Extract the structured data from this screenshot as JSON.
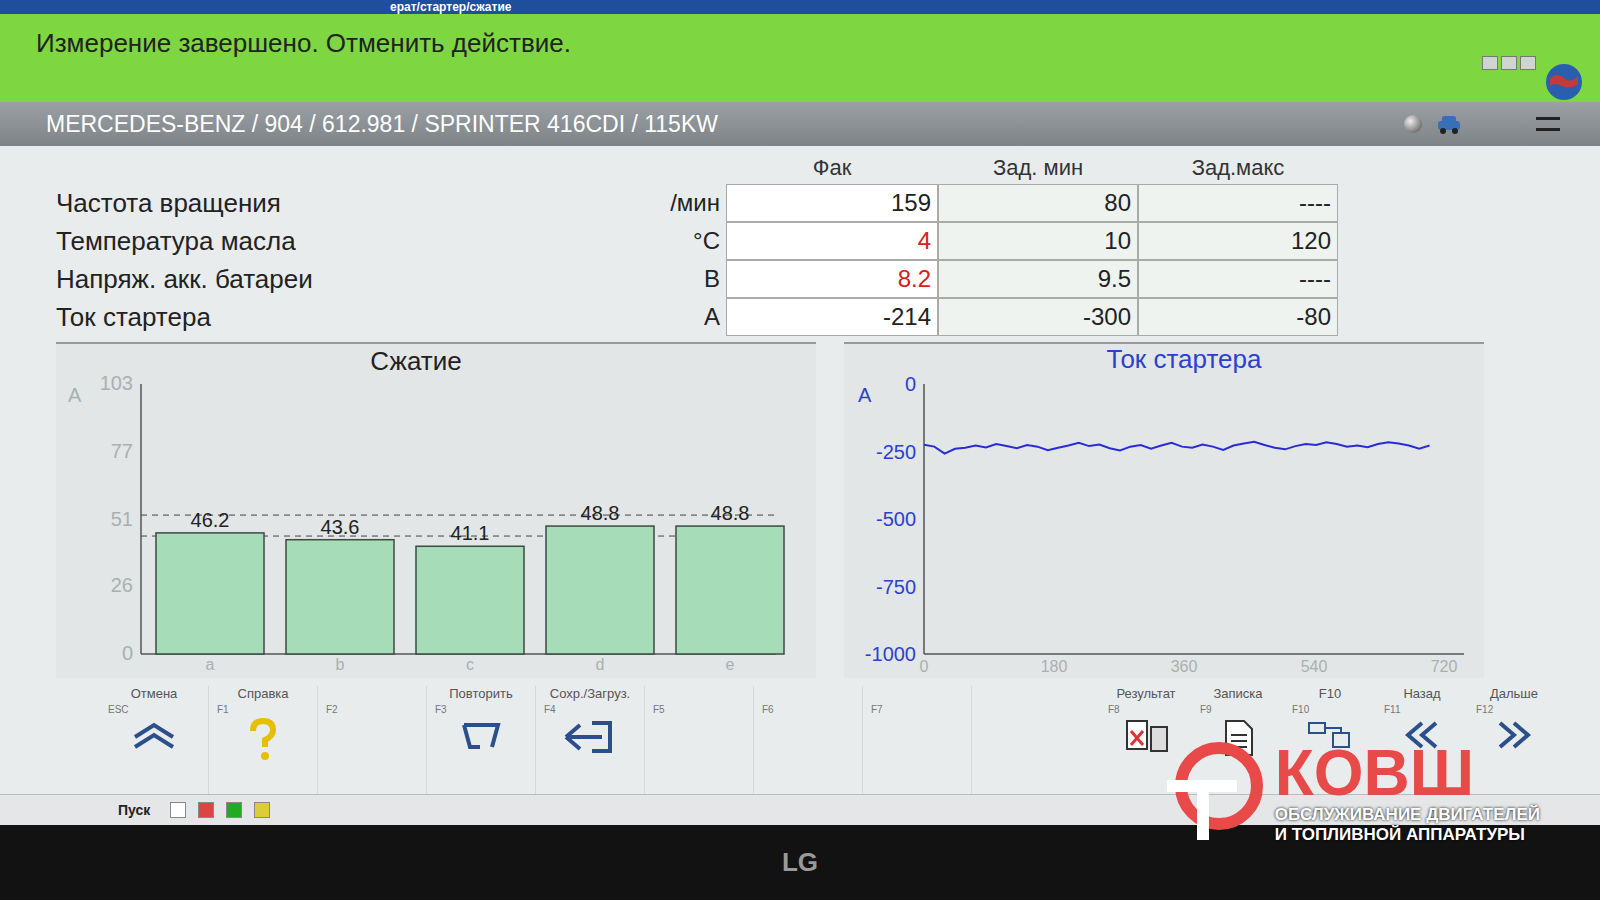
{
  "path": "ерат/стартер/сжатие",
  "banner": {
    "message": "Измерение завершено. Отменить действие."
  },
  "vehicle": "MERCEDES-BENZ / 904 / 612.981 / SPRINTER 416CDI / 115KW",
  "table": {
    "columns": [
      "Фак",
      "Зад. мин",
      "Зад.макс"
    ],
    "rows": [
      {
        "name": "Частота вращения",
        "unit": "/мин",
        "actual": "159",
        "alarm": false,
        "min": "80",
        "max": "----"
      },
      {
        "name": "Температура масла",
        "unit": "°C",
        "actual": "4",
        "alarm": true,
        "min": "10",
        "max": "120"
      },
      {
        "name": "Напряж. акк. батареи",
        "unit": "В",
        "actual": "8.2",
        "alarm": true,
        "min": "9.5",
        "max": "----"
      },
      {
        "name": "Ток стартера",
        "unit": "А",
        "actual": "-214",
        "alarm": false,
        "min": "-300",
        "max": "-80"
      }
    ]
  },
  "compression_chart": {
    "title": "Сжатие",
    "axis_label": "A",
    "y_ticks": [
      "103",
      "77",
      "51",
      "26",
      "0"
    ],
    "y_max": 103,
    "bars": [
      {
        "label": "a",
        "value": 46.2,
        "text": "46.2"
      },
      {
        "label": "b",
        "value": 43.6,
        "text": "43.6"
      },
      {
        "label": "c",
        "value": 41.1,
        "text": "41.1"
      },
      {
        "label": "d",
        "value": 48.8,
        "text": "48.8"
      },
      {
        "label": "e",
        "value": 48.8,
        "text": "48.8"
      }
    ],
    "reference_lines": [
      53,
      45
    ]
  },
  "current_chart": {
    "title": "Ток стартера",
    "axis_label": "A",
    "y_ticks": [
      "0",
      "-250",
      "-500",
      "-750",
      "-1000"
    ],
    "x_ticks": [
      "0",
      "180",
      "360",
      "540",
      "720"
    ],
    "x_max": 720,
    "y_min": -1000,
    "series": [
      -225,
      -232,
      -258,
      -240,
      -236,
      -228,
      -235,
      -222,
      -230,
      -238,
      -226,
      -232,
      -245,
      -236,
      -228,
      -218,
      -230,
      -224,
      -238,
      -246,
      -232,
      -226,
      -240,
      -228,
      -218,
      -232,
      -236,
      -224,
      -232,
      -244,
      -228,
      -220,
      -214,
      -226,
      -236,
      -242,
      -230,
      -222,
      -226,
      -216,
      -222,
      -232,
      -228,
      -234,
      -222,
      -216,
      -220,
      -228,
      -240,
      -228
    ]
  },
  "function_keys": [
    {
      "key": "ESC",
      "label": "Отмена"
    },
    {
      "key": "F1",
      "label": "Справка"
    },
    {
      "key": "F2",
      "label": ""
    },
    {
      "key": "F3",
      "label": "Повторить"
    },
    {
      "key": "F4",
      "label": "Сохр./Загруз."
    },
    {
      "key": "F5",
      "label": ""
    },
    {
      "key": "F6",
      "label": ""
    },
    {
      "key": "F7",
      "label": ""
    },
    {
      "key": "F8",
      "label": "Результат"
    },
    {
      "key": "F9",
      "label": "Записка"
    },
    {
      "key": "F10",
      "label": "F10"
    },
    {
      "key": "F11",
      "label": "Назад"
    },
    {
      "key": "F12",
      "label": "Дальше"
    }
  ],
  "taskbar": {
    "start": "Пуск"
  },
  "watermark": {
    "logo": "КОВШ",
    "lines": [
      "ОБСЛУЖИВАНИЕ ДВИГАТЕЛЕЙ",
      "И ТОПЛИВНОЙ АППАРАТУРЫ"
    ]
  },
  "monitor": {
    "brand": "LG"
  }
}
